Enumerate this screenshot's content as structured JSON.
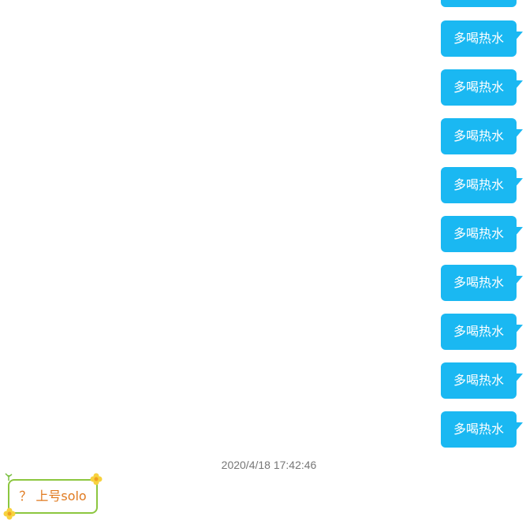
{
  "messages": [
    {
      "text": "多喝热水"
    },
    {
      "text": "多喝热水"
    },
    {
      "text": "多喝热水"
    },
    {
      "text": "多喝热水"
    },
    {
      "text": "多喝热水"
    },
    {
      "text": "多喝热水"
    },
    {
      "text": "多喝热水"
    },
    {
      "text": "多喝热水"
    },
    {
      "text": "多喝热水"
    }
  ],
  "timestamp": "2020/4/18 17:42:46",
  "incoming_message": {
    "text": "？ 上号solo"
  },
  "colors": {
    "outgoing_bubble": "#1ab8f2",
    "incoming_border": "#8cc63f",
    "incoming_text": "#e07a1f"
  },
  "icons": {
    "bubble_flower": "flower-icon",
    "bubble_leaf": "leaf-icon"
  }
}
